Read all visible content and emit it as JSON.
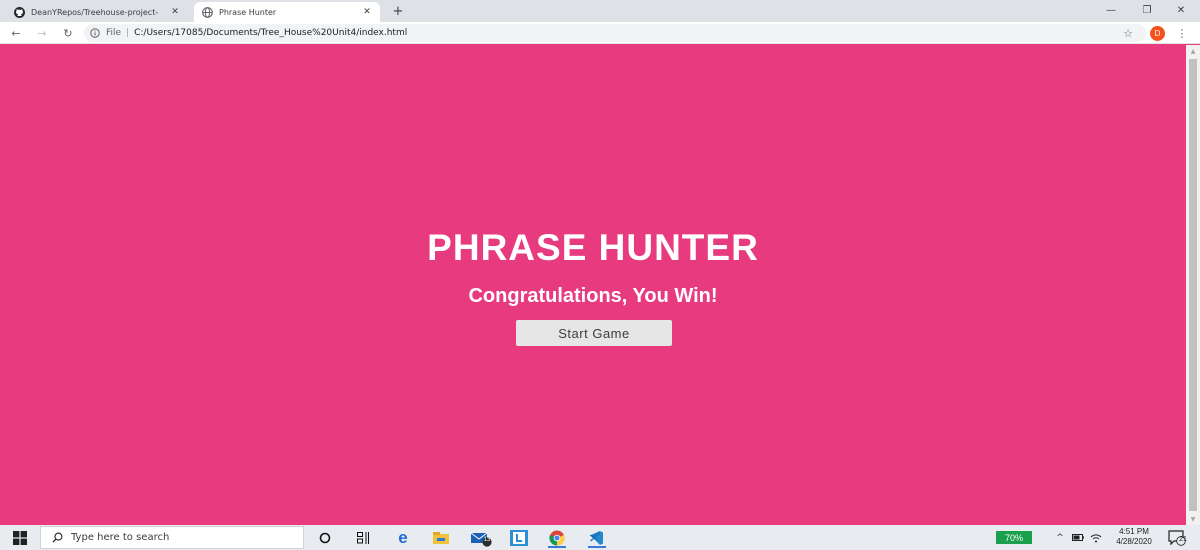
{
  "browser": {
    "tabs": [
      {
        "title": "DeanYRepos/Treehouse-project-",
        "active": false,
        "favicon": "github-icon"
      },
      {
        "title": "Phrase Hunter",
        "active": true,
        "favicon": "globe-icon"
      }
    ],
    "new_tab_label": "+",
    "address": {
      "scheme_label": "File",
      "url": "C:/Users/17085/Documents/Tree_House%20Unit4/index.html"
    },
    "profile_initial": "D"
  },
  "page": {
    "title": "PHRASE HUNTER",
    "message": "Congratulations, You Win!",
    "start_button_label": "Start Game",
    "background_color": "#e83a7e"
  },
  "taskbar": {
    "search_placeholder": "Type here to search",
    "mail_badge": "13",
    "battery_label": "70%",
    "time": "4:51 PM",
    "date": "4/28/2020",
    "notification_count": "21"
  }
}
